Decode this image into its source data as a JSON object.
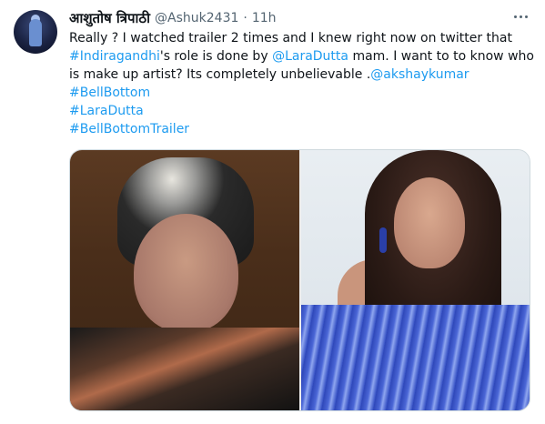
{
  "tweet": {
    "author": {
      "name": "आशुतोष त्रिपाठी",
      "handle": "@Ashuk2431",
      "separator": "·",
      "time": "11h"
    },
    "text": {
      "part1": "Really ? I watched trailer 2 times and I knew right now on twitter that ",
      "hashtag1": "#Indiragandhi",
      "part2": "'s role is done by  ",
      "mention1": "@LaraDutta",
      "part3": " mam. I want to to know who is make up artist? Its completely unbelievable .",
      "mention2": "@akshaykumar"
    },
    "hashtags": [
      "#BellBottom",
      "#LaraDutta",
      "#BellBottomTrailer"
    ]
  },
  "colors": {
    "link": "#1d9bf0",
    "text": "#0f1419",
    "secondary": "#536471"
  },
  "icons": {
    "more": "more-horizontal-icon"
  }
}
